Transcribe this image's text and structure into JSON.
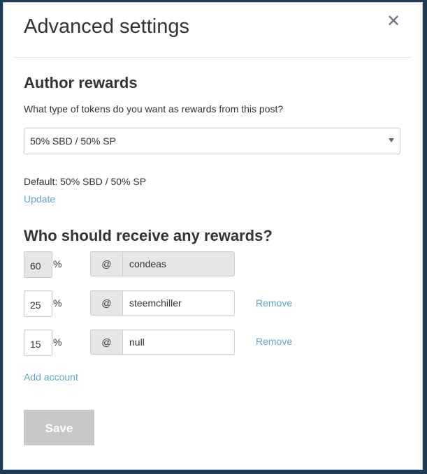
{
  "title": "Advanced settings",
  "author_rewards": {
    "heading": "Author rewards",
    "question": "What type of tokens do you want as rewards from this post?",
    "selected": "50% SBD / 50% SP",
    "default_text": "Default: 50% SBD / 50% SP",
    "update_label": "Update"
  },
  "beneficiaries": {
    "heading": "Who should receive any rewards?",
    "percent_sign": "%",
    "at_sign": "@",
    "remove_label": "Remove",
    "add_label": "Add account",
    "rows": [
      {
        "percent": "60",
        "account": "condeas",
        "disabled": true
      },
      {
        "percent": "25",
        "account": "steemchiller"
      },
      {
        "percent": "15",
        "account": "null"
      }
    ]
  },
  "save_label": "Save"
}
